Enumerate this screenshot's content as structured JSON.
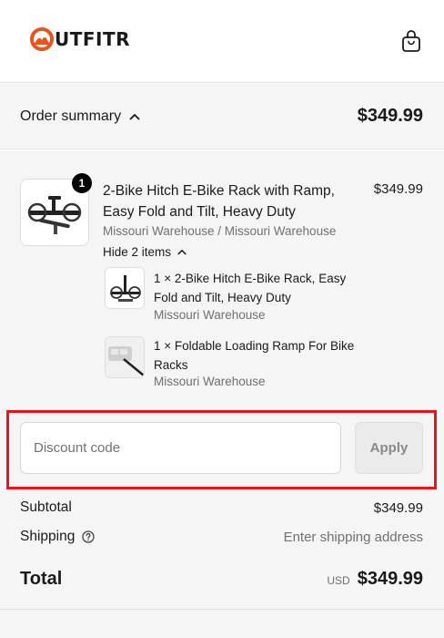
{
  "brand": {
    "name": "UTFITR",
    "logo_letter": "O"
  },
  "header": {
    "cart_icon": "shopping-bag-icon"
  },
  "summary": {
    "label": "Order summary",
    "total": "$349.99"
  },
  "product": {
    "quantity": "1",
    "title": "2-Bike Hitch E-Bike Rack with Ramp, Easy Fold and Tilt, Heavy Duty",
    "price": "$349.99",
    "warehouse": "Missouri Warehouse / Missouri Warehouse",
    "toggle_label": "Hide 2 items",
    "items": [
      {
        "title": "1 × 2-Bike Hitch E-Bike Rack, Easy Fold and Tilt, Heavy Duty",
        "warehouse": "Missouri Warehouse"
      },
      {
        "title": "1 × Foldable Loading Ramp For Bike Racks",
        "warehouse": "Missouri Warehouse"
      }
    ]
  },
  "discount": {
    "placeholder": "Discount code",
    "apply_label": "Apply"
  },
  "costs": {
    "subtotal_label": "Subtotal",
    "subtotal_value": "$349.99",
    "shipping_label": "Shipping",
    "shipping_value": "Enter shipping address",
    "total_label": "Total",
    "currency": "USD",
    "total_value": "$349.99"
  },
  "colors": {
    "brand_orange": "#e8541c",
    "highlight_red": "#e8141c",
    "panel_bg": "#f5f5f5"
  }
}
